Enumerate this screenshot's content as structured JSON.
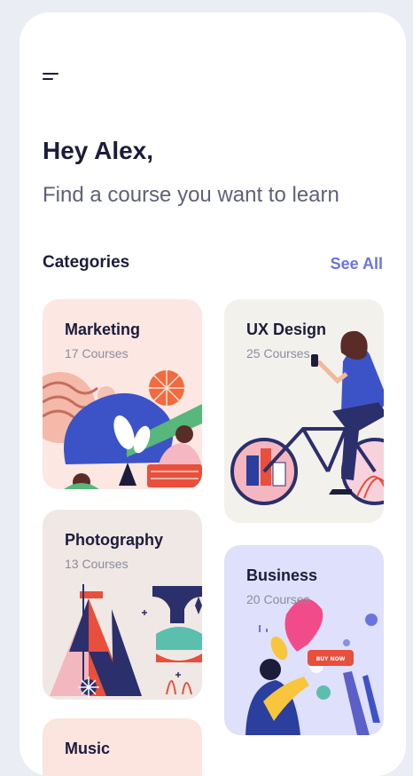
{
  "header": {
    "menu_icon": "hamburger-menu-icon"
  },
  "greeting": "Hey Alex,",
  "subtitle": "Find a course you want to learn",
  "categories_section": {
    "title": "Categories",
    "see_all_label": "See All"
  },
  "categories": [
    {
      "title": "Marketing",
      "count": "17 Courses",
      "bg": "#fce7e2"
    },
    {
      "title": "UX Design",
      "count": "25 Courses",
      "bg": "#f3f1ec"
    },
    {
      "title": "Photography",
      "count": "13 Courses",
      "bg": "#efe8e4"
    },
    {
      "title": "Business",
      "count": "20 Courses",
      "bg": "#dfe0fb",
      "illustration_button": "BUY NOW"
    },
    {
      "title": "Music",
      "bg": "#fce4df"
    }
  ],
  "colors": {
    "accent": "#6b74e0",
    "text_primary": "#1c1c3b",
    "text_secondary": "#5f6176",
    "muted": "#8a8d9e",
    "app_bg": "#ebedf5"
  }
}
